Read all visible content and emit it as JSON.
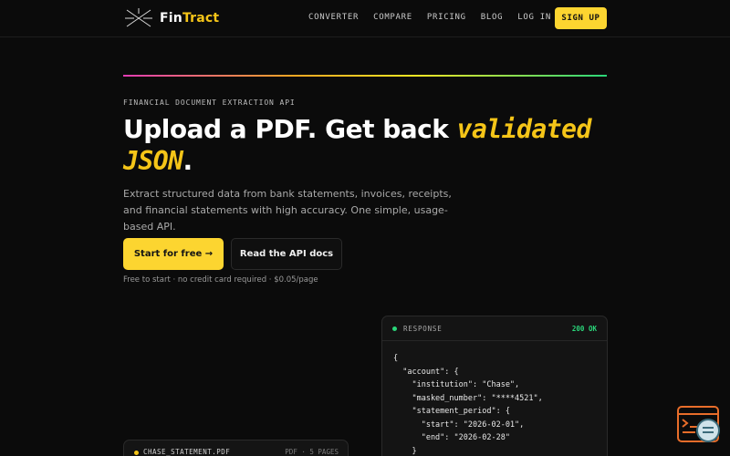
{
  "brand": {
    "name_part1": "Fin",
    "name_part2": "Tract",
    "accent": "#f5c518"
  },
  "nav": {
    "links": [
      "CONVERTER",
      "COMPARE",
      "PRICING",
      "BLOG",
      "LOG IN"
    ],
    "signup_label": "SIGN UP"
  },
  "hero": {
    "eyebrow": "FINANCIAL DOCUMENT EXTRACTION API",
    "headline_plain": "Upload a PDF. Get back ",
    "headline_highlight": "validated JSON",
    "headline_end": ".",
    "subtitle": "Extract structured data from bank statements, invoices, receipts, and financial statements with high accuracy. One simple, usage-based API.",
    "primary_cta": "Start for free →",
    "secondary_cta": "Read the API docs",
    "fineprint": "Free to start · no credit card required · $0.05/page"
  },
  "response_panel": {
    "title": "RESPONSE",
    "status": "200 OK",
    "code_lines": [
      "{",
      "  \"account\": {",
      "    \"institution\": \"Chase\",",
      "    \"masked_number\": \"****4521\",",
      "    \"statement_period\": {",
      "      \"start\": \"2026-02-01\",",
      "      \"end\": \"2026-02-28\"",
      "    }"
    ]
  },
  "file_card": {
    "filename": "CHASE_STATEMENT.PDF",
    "meta": "PDF · 5 PAGES"
  },
  "widget": {
    "icon": "chat-widget-icon"
  }
}
